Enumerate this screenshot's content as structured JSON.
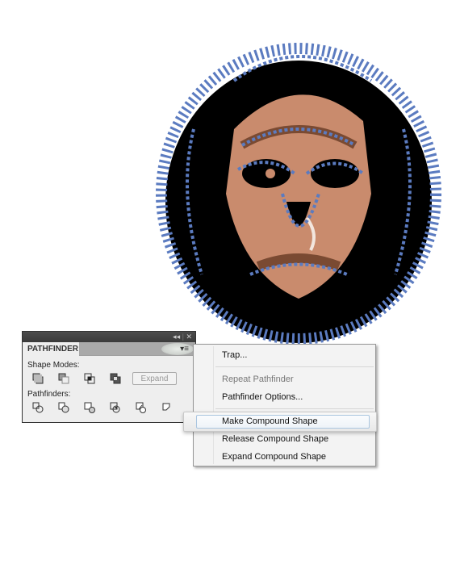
{
  "artwork": {
    "description": "Illustrated ape face with selected vector paths",
    "colors": {
      "selection": "#5b7bc0",
      "skin": "#c98b6d",
      "shadow": "#7a4a32",
      "outline": "#000000",
      "highlight": "#f2e6de"
    }
  },
  "panel": {
    "tab_label": "PATHFINDER",
    "collapse_icon": "double-chevron-left-icon",
    "close_icon": "close-icon",
    "menu_icon": "panel-menu-icon",
    "shape_modes_label": "Shape Modes:",
    "shape_modes": [
      {
        "name": "unite",
        "icon": "unite-icon"
      },
      {
        "name": "minus-front",
        "icon": "minus-front-icon"
      },
      {
        "name": "intersect",
        "icon": "intersect-icon"
      },
      {
        "name": "exclude",
        "icon": "exclude-icon"
      }
    ],
    "expand_label": "Expand",
    "pathfinders_label": "Pathfinders:",
    "pathfinders": [
      {
        "name": "divide",
        "icon": "divide-icon"
      },
      {
        "name": "trim",
        "icon": "trim-icon"
      },
      {
        "name": "merge",
        "icon": "merge-icon"
      },
      {
        "name": "crop",
        "icon": "crop-icon"
      },
      {
        "name": "outline",
        "icon": "outline-icon"
      },
      {
        "name": "minus-back",
        "icon": "minus-back-icon"
      }
    ]
  },
  "menu": {
    "items": [
      {
        "label": "Trap...",
        "enabled": true
      },
      {
        "label": "Repeat Pathfinder",
        "enabled": false
      },
      {
        "label": "Pathfinder Options...",
        "enabled": true
      },
      {
        "label": "Make Compound Shape",
        "enabled": true,
        "highlighted": true
      },
      {
        "label": "Release Compound Shape",
        "enabled": true
      },
      {
        "label": "Expand Compound Shape",
        "enabled": true
      }
    ]
  }
}
